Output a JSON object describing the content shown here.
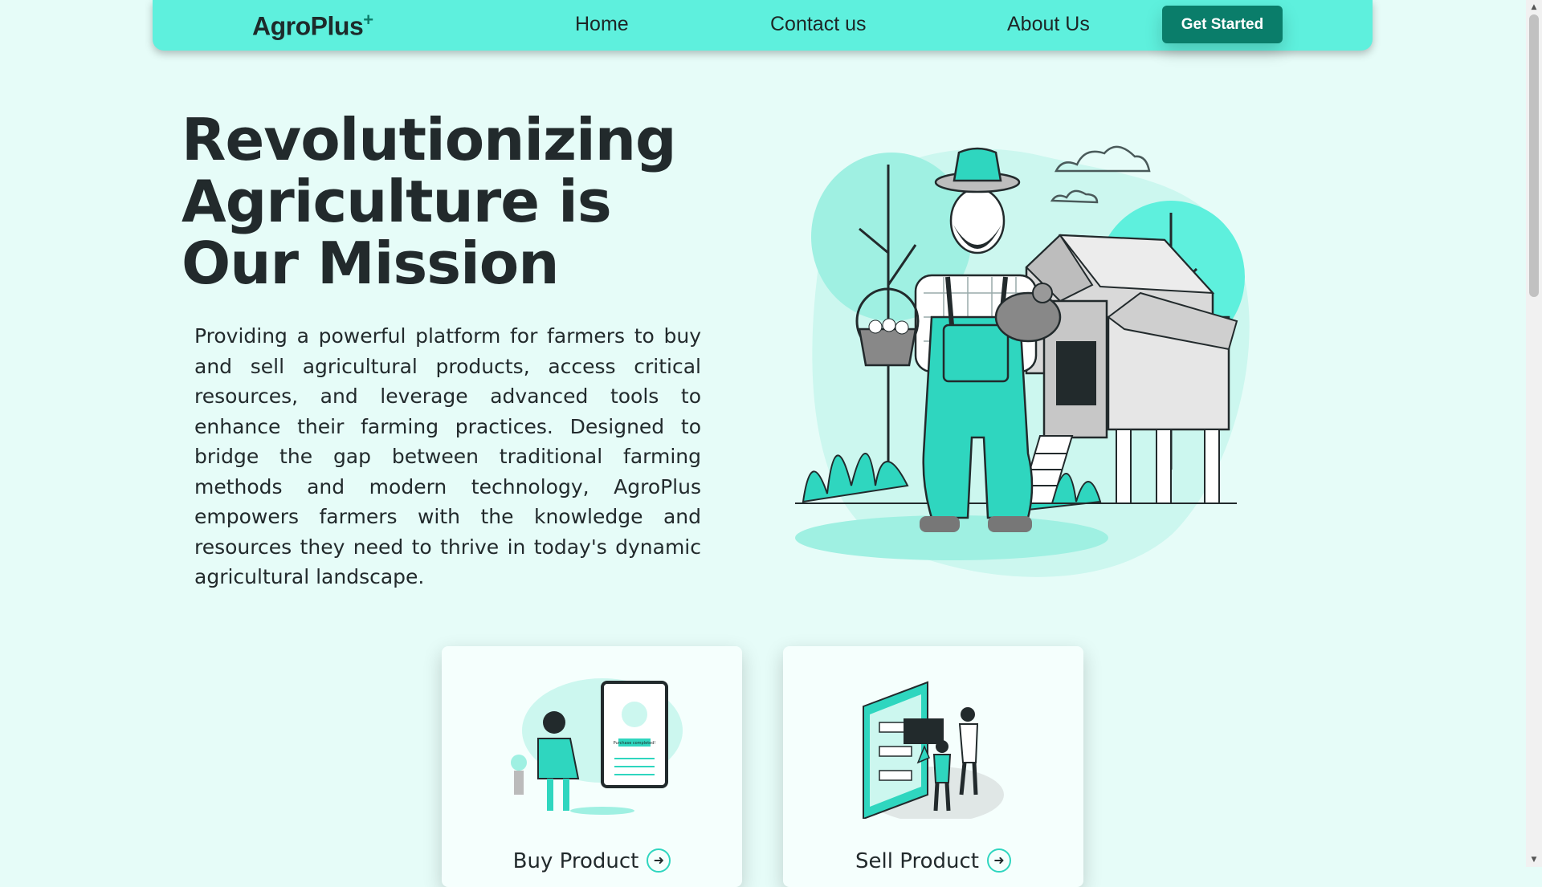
{
  "nav": {
    "logo": "AgroPlus",
    "logo_mark": "+",
    "links": [
      {
        "label": "Home"
      },
      {
        "label": "Contact us"
      },
      {
        "label": "About Us"
      }
    ],
    "cta_label": "Get Started"
  },
  "hero": {
    "title": "Revolutionizing Agriculture is Our Mission",
    "description": "Providing a powerful platform for farmers to buy and sell agricultural products, access critical resources, and leverage advanced tools to enhance their farming practices. Designed to bridge the gap between traditional farming methods and modern technology, AgroPlus empowers farmers with the knowledge and resources they need to thrive in today's dynamic agricultural landscape."
  },
  "cards": [
    {
      "label": "Buy Product",
      "mini_text": "Purchase completed!"
    },
    {
      "label": "Sell Product"
    }
  ],
  "colors": {
    "background": "#e6fcf8",
    "navbar": "#5ef0dd",
    "accent": "#2fd6bf",
    "button": "#0a7d6a",
    "text": "#222a2c"
  }
}
